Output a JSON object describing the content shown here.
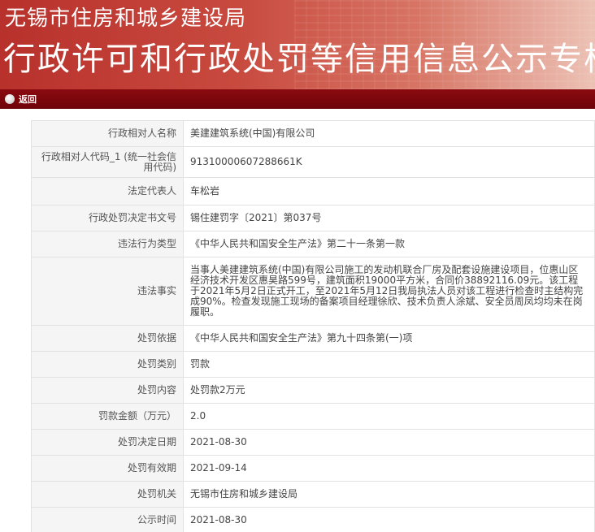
{
  "banner": {
    "org": "无锡市住房和城乡建设局",
    "title": "行政许可和行政处罚等信用信息公示专栏"
  },
  "nav": {
    "back_label": "返回"
  },
  "rows": [
    {
      "label": "行政相对人名称",
      "value": "美建建筑系统(中国)有限公司"
    },
    {
      "label": "行政相对人代码_1 (统一社会信用代码)",
      "value": "91310000607288661K"
    },
    {
      "label": "法定代表人",
      "value": "车松岩"
    },
    {
      "label": "行政处罚决定书文号",
      "value": "锡住建罚字〔2021〕第037号"
    },
    {
      "label": "违法行为类型",
      "value": "《中华人民共和国安全生产法》第二十一条第一款"
    },
    {
      "label": "违法事实",
      "value": "当事人美建建筑系统(中国)有限公司施工的发动机联合厂房及配套设施建设项目，位惠山区经济技术开发区惠昊路599号，建筑面积19000平方米，合同价38892116.09元。该工程于2021年5月2日正式开工，至2021年5月12日我局执法人员对该工程进行检查时主结构完成90%。检查发现施工现场的备案项目经理徐欣、技术负责人涂斌、安全员周凤均均未在岗履职。"
    },
    {
      "label": "处罚依据",
      "value": "《中华人民共和国安全生产法》第九十四条第(一)项"
    },
    {
      "label": "处罚类别",
      "value": "罚款"
    },
    {
      "label": "处罚内容",
      "value": "处罚款2万元"
    },
    {
      "label": "罚款金额（万元）",
      "value": "2.0"
    },
    {
      "label": "处罚决定日期",
      "value": "2021-08-30"
    },
    {
      "label": "处罚有效期",
      "value": "2021-09-14"
    },
    {
      "label": "处罚机关",
      "value": "无锡市住房和城乡建设局"
    },
    {
      "label": "公示时间",
      "value": "2021-08-30"
    }
  ]
}
